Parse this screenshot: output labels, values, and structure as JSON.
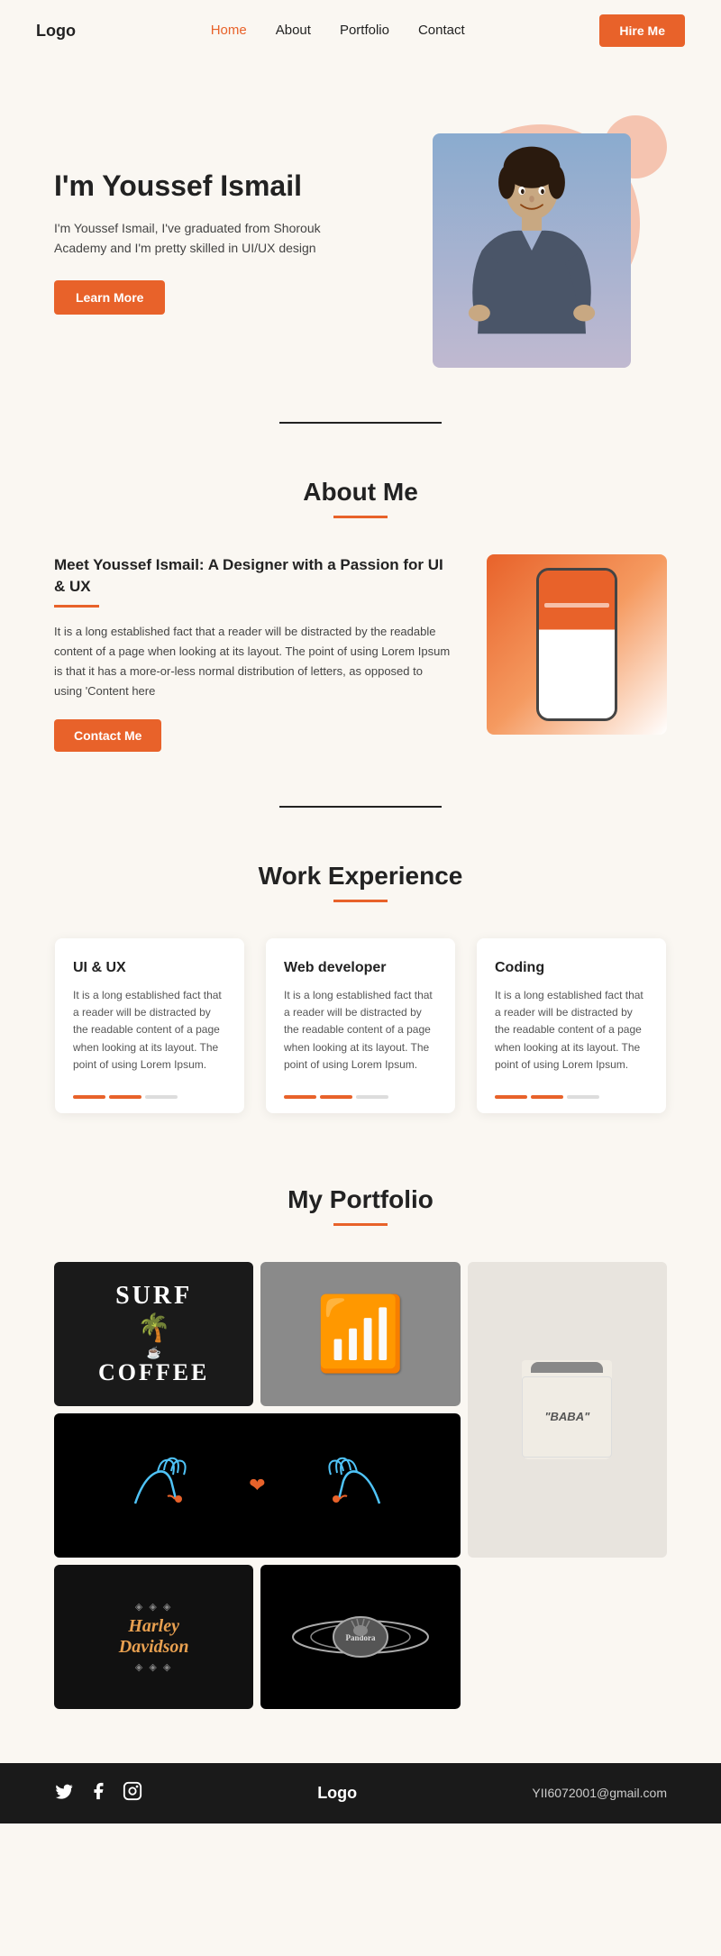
{
  "nav": {
    "logo": "Logo",
    "links": [
      {
        "label": "Home",
        "active": true
      },
      {
        "label": "About",
        "active": false
      },
      {
        "label": "Portfolio",
        "active": false
      },
      {
        "label": "Contact",
        "active": false
      }
    ],
    "hire_button": "Hire Me"
  },
  "hero": {
    "heading": "I'm Youssef Ismail",
    "description": "I'm Youssef Ismail, I've graduated from Shorouk Academy and I'm pretty skilled in UI/UX design",
    "learn_btn": "Learn More"
  },
  "about": {
    "section_title": "About Me",
    "subtitle": "Meet Youssef Ismail: A Designer with a Passion for UI & UX",
    "body": "It is a long established fact that a reader will be distracted by the readable content of a page when looking at its layout. The point of using Lorem Ipsum is that it has a more-or-less normal distribution of letters, as opposed to using 'Content here",
    "contact_btn": "Contact Me"
  },
  "work": {
    "section_title": "Work Experience",
    "cards": [
      {
        "title": "UI & UX",
        "desc": "It is a long established fact that a reader will be distracted by the readable content of a page when looking at its layout. The point of using Lorem Ipsum.",
        "bar_filled": 2,
        "bar_total": 3
      },
      {
        "title": "Web developer",
        "desc": "It is a long established fact that a reader will be distracted by the readable content of a page when looking at its layout. The point of using Lorem Ipsum.",
        "bar_filled": 2,
        "bar_total": 3
      },
      {
        "title": "Coding",
        "desc": "It is a long established fact that a reader will be distracted by the readable content of a page when looking at its layout. The point of using Lorem Ipsum.",
        "bar_filled": 2,
        "bar_total": 3
      }
    ]
  },
  "portfolio": {
    "section_title": "My Portfolio",
    "items": [
      {
        "id": "surf-coffee",
        "label": "Surf Coffee Logo"
      },
      {
        "id": "wifi",
        "label": "WiFi Sign"
      },
      {
        "id": "baba-bag",
        "label": "Baba Packaging"
      },
      {
        "id": "hands",
        "label": "Hands Neon Art"
      },
      {
        "id": "harley",
        "label": "Harley Davidson"
      },
      {
        "id": "pandora",
        "label": "Pandora Emblem"
      }
    ]
  },
  "footer": {
    "logo": "Logo",
    "email": "YII6072001@gmail.com",
    "socials": [
      {
        "name": "twitter",
        "label": "Twitter"
      },
      {
        "name": "facebook",
        "label": "Facebook"
      },
      {
        "name": "instagram",
        "label": "Instagram"
      }
    ]
  }
}
